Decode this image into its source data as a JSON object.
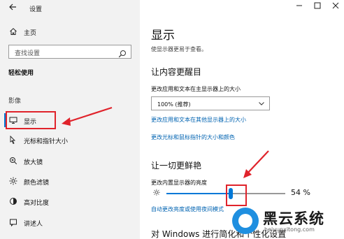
{
  "window": {
    "app_title": "设置",
    "back_icon": "arrow-left-icon",
    "controls": [
      "minimize-icon",
      "maximize-icon",
      "close-icon"
    ]
  },
  "sidebar": {
    "home_label": "主页",
    "search_placeholder": "查找设置",
    "section_title": "轻松使用",
    "group_label": "影像",
    "items": [
      {
        "label": "显示",
        "icon": "monitor-icon",
        "selected": true
      },
      {
        "label": "光标和指针大小",
        "icon": "cursor-icon"
      },
      {
        "label": "放大镜",
        "icon": "magnifier-icon"
      },
      {
        "label": "颜色滤镜",
        "icon": "color-filter-icon"
      },
      {
        "label": "高对比度",
        "icon": "contrast-icon"
      },
      {
        "label": "讲述人",
        "icon": "narrator-icon"
      }
    ]
  },
  "main": {
    "title": "显示",
    "description": "使显示器更易于查看。",
    "section1_title": "让内容更醒目",
    "text_size_label": "更改应用和文本在主显示器上的大小",
    "scale_select_value": "100% (推荐)",
    "link1": "更改应用和文本在其他显示器上的大小",
    "link2": "更改光标和鼠标指针的大小和颜色",
    "section2_title": "让一切更鲜艳",
    "brightness_label": "更改内置显示器的亮度",
    "brightness_value": 54,
    "brightness_text": "54 %",
    "link3": "自动更改亮度或使用夜间模式",
    "section3_title": "对 Windows 进行简化和个性化设置"
  },
  "colors": {
    "accent": "#0078d7",
    "link": "#0063b1",
    "highlight": "#e0232b",
    "sidebar_bg": "#f2f2f2"
  },
  "watermark": {
    "brand": "黑云系统",
    "url": "heiyunxitong.com"
  }
}
